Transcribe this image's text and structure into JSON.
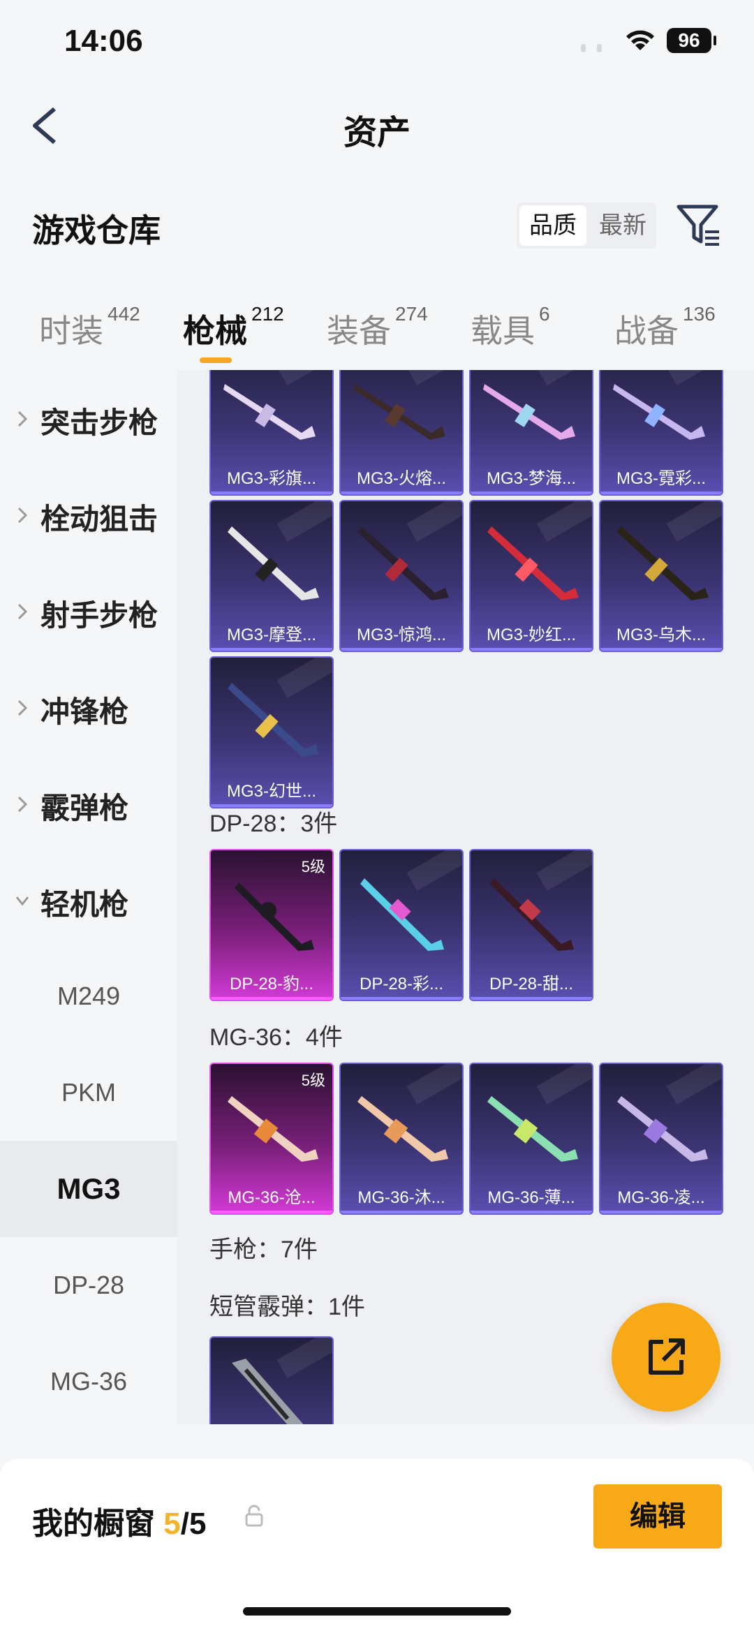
{
  "status_bar": {
    "time": "14:06",
    "battery": "96"
  },
  "nav": {
    "title": "资产"
  },
  "header": {
    "title": "游戏仓库",
    "sort_options": [
      "品质",
      "最新"
    ],
    "sort_selected": "品质"
  },
  "tabs": [
    {
      "label": "时装",
      "count": "442"
    },
    {
      "label": "枪械",
      "count": "212"
    },
    {
      "label": "装备",
      "count": "274"
    },
    {
      "label": "载具",
      "count": "6"
    },
    {
      "label": "战备",
      "count": "136"
    }
  ],
  "tab_active": "枪械",
  "sidebar": {
    "categories": [
      "突击步枪",
      "栓动狙击",
      "射手步枪",
      "冲锋枪",
      "霰弹枪",
      "轻机枪"
    ],
    "subitems": [
      "M249",
      "PKM",
      "MG3",
      "DP-28",
      "MG-36"
    ],
    "selected_subitem": "MG3"
  },
  "content": {
    "mg3_row1": [
      "MG3-彩旗...",
      "MG3-火熔...",
      "MG3-梦海...",
      "MG3-霓彩..."
    ],
    "mg3_row2": [
      "MG3-摩登...",
      "MG3-惊鸿...",
      "MG3-妙红...",
      "MG3-乌木..."
    ],
    "mg3_row3": [
      "MG3-幻世..."
    ],
    "dp28_label": "DP-28：3件",
    "dp28_items": [
      {
        "name": "DP-28-豹...",
        "level": "5级"
      },
      {
        "name": "DP-28-彩...",
        "level": ""
      },
      {
        "name": "DP-28-甜...",
        "level": ""
      }
    ],
    "mg36_label": "MG-36：4件",
    "mg36_items": [
      {
        "name": "MG-36-沧...",
        "level": "5级"
      },
      {
        "name": "MG-36-沐...",
        "level": ""
      },
      {
        "name": "MG-36-薄...",
        "level": ""
      },
      {
        "name": "MG-36-凌...",
        "level": ""
      }
    ],
    "pistol_label": "手枪：7件",
    "shotgun_label": "短管霰弹：1件"
  },
  "bottom": {
    "showcase_label": "我的橱窗",
    "showcase_current": "5",
    "showcase_total": "/5",
    "edit_label": "编辑"
  },
  "colors": {
    "accent": "#f8a917",
    "purple_card": "#5a4fb0",
    "gold_card": "#d23ad6"
  }
}
